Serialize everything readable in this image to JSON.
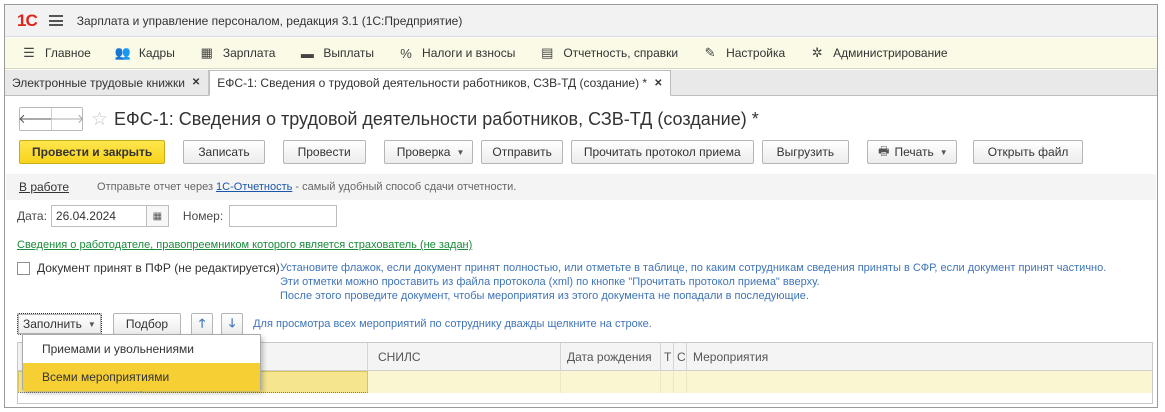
{
  "app": {
    "logo": "1С",
    "title": "Зарплата и управление персоналом, редакция 3.1  (1С:Предприятие)"
  },
  "menu": [
    {
      "icon": "hamburger-icon",
      "glyph": "☰",
      "label": "Главное"
    },
    {
      "icon": "users-icon",
      "glyph": "👥",
      "label": "Кадры"
    },
    {
      "icon": "calculator-icon",
      "glyph": "▦",
      "label": "Зарплата"
    },
    {
      "icon": "money-icon",
      "glyph": "▬",
      "label": "Выплаты"
    },
    {
      "icon": "percent-icon",
      "glyph": "%",
      "label": "Налоги и взносы"
    },
    {
      "icon": "report-icon",
      "glyph": "▤",
      "label": "Отчетность, справки"
    },
    {
      "icon": "wrench-icon",
      "glyph": "✎",
      "label": "Настройка"
    },
    {
      "icon": "gear-icon",
      "glyph": "✲",
      "label": "Администрирование"
    }
  ],
  "tabs": [
    {
      "label": "Электронные трудовые книжки",
      "active": false
    },
    {
      "label": "ЕФС-1: Сведения о трудовой деятельности работников, СЗВ-ТД (создание) *",
      "active": true
    }
  ],
  "document": {
    "title": "ЕФС-1: Сведения о трудовой деятельности работников, СЗВ-ТД (создание) *"
  },
  "toolbar": {
    "post_close": "Провести и закрыть",
    "save": "Записать",
    "post": "Провести",
    "check": "Проверка",
    "send": "Отправить",
    "read_protocol": "Прочитать протокол приема",
    "export": "Выгрузить",
    "print": "Печать",
    "open_file": "Открыть файл"
  },
  "info": {
    "status": "В работе",
    "text_before": "Отправьте отчет через ",
    "link": "1С-Отчетность",
    "text_after": " - самый удобный способ сдачи отчетности."
  },
  "form": {
    "date_label": "Дата:",
    "date_value": "26.04.2024",
    "number_label": "Номер:",
    "number_value": "",
    "employer_link": "Сведения о работодателе, правопреемником которого является страхователь (не задан)",
    "accepted_label": "Документ принят в ПФР (не редактируется)",
    "accepted_checked": false,
    "hint_lines": [
      "Установите флажок, если документ принят полностью, или отметьте в таблице, по каким сотрудникам сведения приняты в СФР, если документ принят частично.",
      "Эти отметки можно проставить из файла протокола (xml) по кнопке \"Прочитать протокол приема\" вверху.",
      "После этого проведите документ, чтобы мероприятия из этого документа не попадали в последующие."
    ]
  },
  "table_toolbar": {
    "fill": "Заполнить",
    "select": "Подбор",
    "hint": "Для просмотра всех мероприятий по сотруднику дважды щелкните на строке."
  },
  "table": {
    "columns": [
      "",
      "",
      "СНИЛС",
      "Дата рождения",
      "Т",
      "С",
      "Мероприятия"
    ]
  },
  "dropdown": {
    "items": [
      {
        "label": "Приемами и увольнениями",
        "selected": false
      },
      {
        "label": "Всеми мероприятиями",
        "selected": true
      }
    ]
  }
}
